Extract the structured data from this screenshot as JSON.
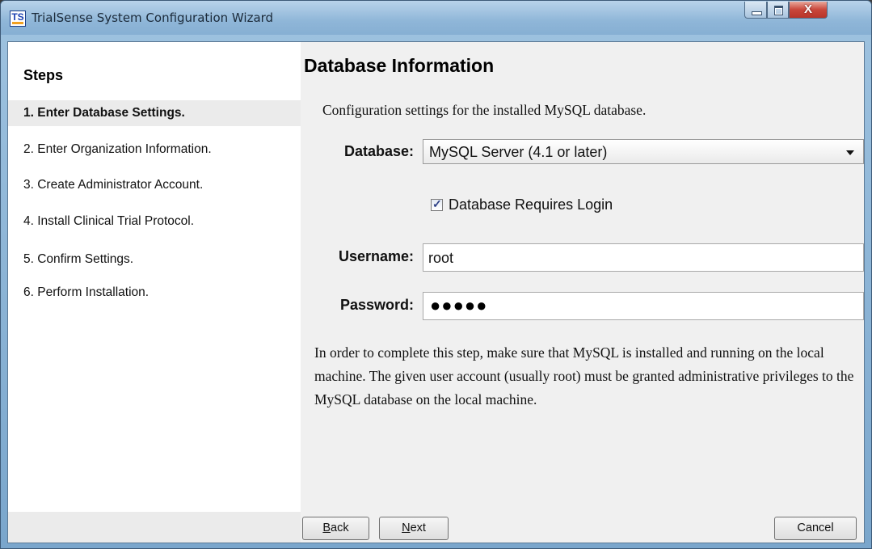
{
  "window": {
    "title": "TrialSense System Configuration Wizard",
    "app_icon_text": "TS",
    "controls": {
      "minimize": "",
      "maximize": "",
      "close": "X"
    }
  },
  "sidebar": {
    "title": "Steps",
    "steps": [
      {
        "label": "1. Enter Database Settings.",
        "active": true
      },
      {
        "label": "2. Enter Organization Information.",
        "active": false
      },
      {
        "label": "3. Create Administrator Account.",
        "active": false
      },
      {
        "label": "4. Install Clinical Trial Protocol.",
        "active": false
      },
      {
        "label": "5. Confirm Settings.",
        "active": false
      },
      {
        "label": "6. Perform Installation.",
        "active": false
      }
    ]
  },
  "main": {
    "title": "Database Information",
    "intro": "Configuration settings for the installed MySQL database.",
    "database_label": "Database:",
    "database_value": "MySQL Server (4.1 or later)",
    "requires_login_label": "Database Requires Login",
    "requires_login_checked": true,
    "username_label": "Username:",
    "username_value": "root",
    "password_label": "Password:",
    "password_mask": "●●●●●",
    "notice": "In order to complete this step, make sure that MySQL is installed and running on the local machine. The given user account (usually root) must be granted administrative privileges to the MySQL database on the local machine."
  },
  "footer": {
    "back_mnemonic": "B",
    "back_rest": "ack",
    "next_mnemonic": "N",
    "next_rest": "ext",
    "cancel_label": "Cancel"
  },
  "colors": {
    "title_bar": "#8fb6d8",
    "close_button": "#c9463a",
    "panel_bg": "#f0f0f0",
    "sidebar_bg": "#ffffff",
    "active_step_bg": "#ebebeb"
  },
  "icons": {
    "app": "trialsense-logo-icon",
    "dropdown": "chevron-down-icon",
    "check": "checkmark-icon"
  }
}
